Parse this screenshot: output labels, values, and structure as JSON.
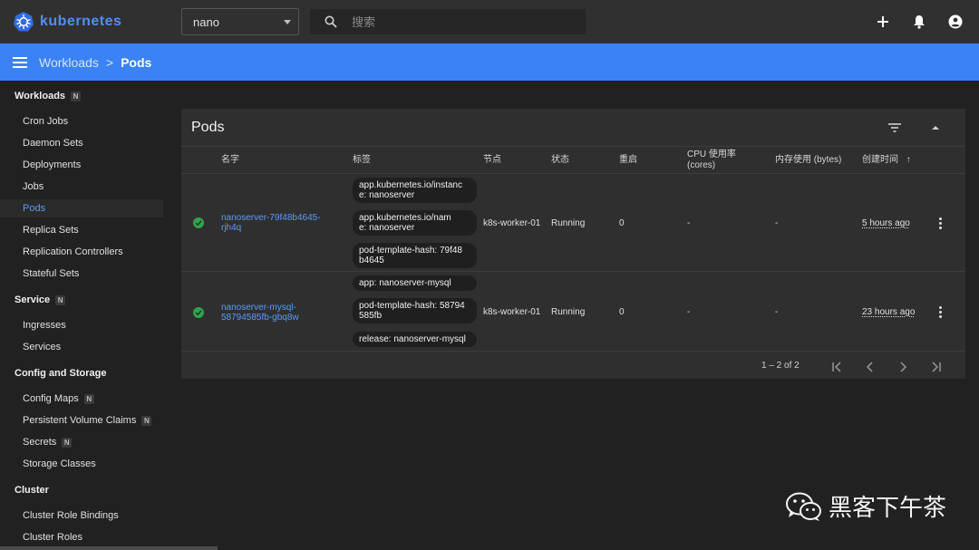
{
  "app": {
    "name": "kubernetes"
  },
  "namespace": {
    "selected": "nano"
  },
  "search": {
    "placeholder": "搜索"
  },
  "breadcrumb": {
    "parent": "Workloads",
    "separator": ">",
    "current": "Pods"
  },
  "sidebar": {
    "sections": [
      {
        "title": "Workloads",
        "badge": "N"
      },
      {
        "title": "Service",
        "badge": "N"
      },
      {
        "title": "Config and Storage"
      },
      {
        "title": "Cluster"
      }
    ],
    "items": [
      {
        "label": "Cron Jobs"
      },
      {
        "label": "Daemon Sets"
      },
      {
        "label": "Deployments"
      },
      {
        "label": "Jobs"
      },
      {
        "label": "Pods",
        "active": true
      },
      {
        "label": "Replica Sets"
      },
      {
        "label": "Replication Controllers"
      },
      {
        "label": "Stateful Sets"
      },
      {
        "label": "Ingresses"
      },
      {
        "label": "Services"
      },
      {
        "label": "Config Maps",
        "badge": "N"
      },
      {
        "label": "Persistent Volume Claims",
        "badge": "N"
      },
      {
        "label": "Secrets",
        "badge": "N"
      },
      {
        "label": "Storage Classes"
      },
      {
        "label": "Cluster Role Bindings"
      },
      {
        "label": "Cluster Roles"
      }
    ]
  },
  "pods_card": {
    "title": "Pods",
    "columns": {
      "name": "名字",
      "labels": "标签",
      "node": "节点",
      "status": "状态",
      "restarts": "重启",
      "cpu": "CPU 使用率",
      "cpu_unit": "(cores)",
      "memory": "内存使用 (bytes)",
      "created": "创建时间",
      "sort_arrow": "↑"
    },
    "rows": [
      {
        "name_line1": "nanoserver-79f48b4645-",
        "name_line2": "rjh4q",
        "labels": [
          {
            "l1": "app.kubernetes.io/instanc",
            "l2": "e: nanoserver"
          },
          {
            "l1": "app.kubernetes.io/nam",
            "l2": "e: nanoserver"
          },
          {
            "l1": "pod-template-hash: 79f48",
            "l2": "b4645"
          }
        ],
        "node": "k8s-worker-01",
        "status": "Running",
        "restarts": "0",
        "cpu": "-",
        "memory": "-",
        "created": "5 hours ago"
      },
      {
        "name_line1": "nanoserver-mysql-",
        "name_line2": "58794585fb-gbq8w",
        "labels": [
          {
            "l1": "app: nanoserver-mysql",
            "l2": ""
          },
          {
            "l1": "pod-template-hash: 58794",
            "l2": "585fb"
          },
          {
            "l1": "release: nanoserver-mysql",
            "l2": ""
          }
        ],
        "node": "k8s-worker-01",
        "status": "Running",
        "restarts": "0",
        "cpu": "-",
        "memory": "-",
        "created": "23 hours ago"
      }
    ],
    "pagination": {
      "range": "1 – 2 of 2"
    }
  },
  "watermark": {
    "text": "黑客下午茶"
  },
  "colors": {
    "accent": "#3b82f6",
    "link": "#5a9cf8",
    "ok": "#2da44e"
  }
}
